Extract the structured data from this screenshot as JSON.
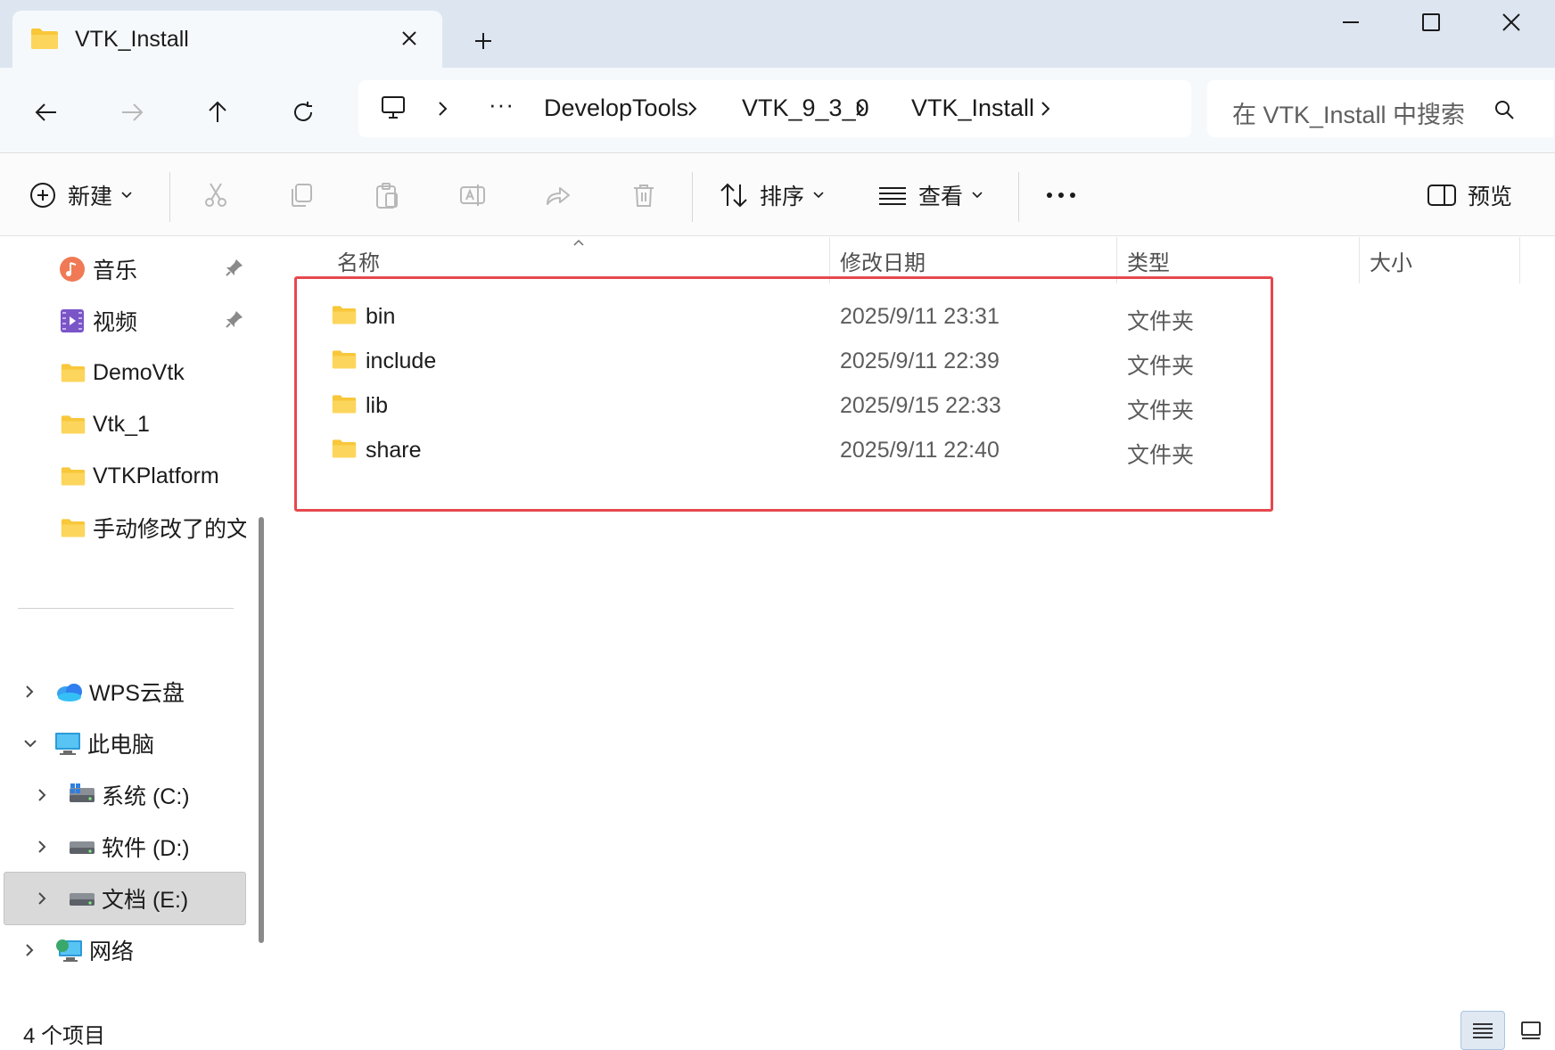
{
  "window": {
    "tab_title": "VTK_Install",
    "new_tab_icon": "plus-icon"
  },
  "address": {
    "crumbs": [
      "DevelopTools",
      "VTK_9_3_0",
      "VTK_Install"
    ],
    "ellipsis": "···",
    "root_icon": "computer-icon"
  },
  "search": {
    "placeholder": "在 VTK_Install 中搜索"
  },
  "toolbar": {
    "new_label": "新建",
    "sort_label": "排序",
    "view_label": "查看",
    "more_label": "···",
    "preview_label": "预览"
  },
  "sidebar": {
    "quick_access": [
      {
        "label": "音乐",
        "icon": "music-icon",
        "pinned": true
      },
      {
        "label": "视频",
        "icon": "video-icon",
        "pinned": true
      },
      {
        "label": "DemoVtk",
        "icon": "folder-icon",
        "pinned": false
      },
      {
        "label": "Vtk_1",
        "icon": "folder-icon",
        "pinned": false
      },
      {
        "label": "VTKPlatform",
        "icon": "folder-icon",
        "pinned": false
      },
      {
        "label": "手动修改了的文件",
        "icon": "folder-icon",
        "pinned": false
      }
    ],
    "wps": "WPS云盘",
    "this_pc": "此电脑",
    "drives": [
      {
        "label": "系统 (C:)",
        "icon": "drive-icon"
      },
      {
        "label": "软件 (D:)",
        "icon": "drive-icon"
      },
      {
        "label": "文档 (E:)",
        "icon": "drive-icon",
        "selected": true
      }
    ],
    "network": "网络"
  },
  "filelist": {
    "columns": {
      "name": "名称",
      "date": "修改日期",
      "type": "类型",
      "size": "大小"
    },
    "rows": [
      {
        "name": "bin",
        "date": "2025/9/11 23:31",
        "type": "文件夹"
      },
      {
        "name": "include",
        "date": "2025/9/11 22:39",
        "type": "文件夹"
      },
      {
        "name": "lib",
        "date": "2025/9/15 22:33",
        "type": "文件夹"
      },
      {
        "name": "share",
        "date": "2025/9/11 22:40",
        "type": "文件夹"
      }
    ]
  },
  "status": {
    "count": "4 个项目"
  },
  "colors": {
    "accent": "#0067c0",
    "highlight_border": "#e5484d",
    "folder_yellow": "#f8c73a"
  }
}
